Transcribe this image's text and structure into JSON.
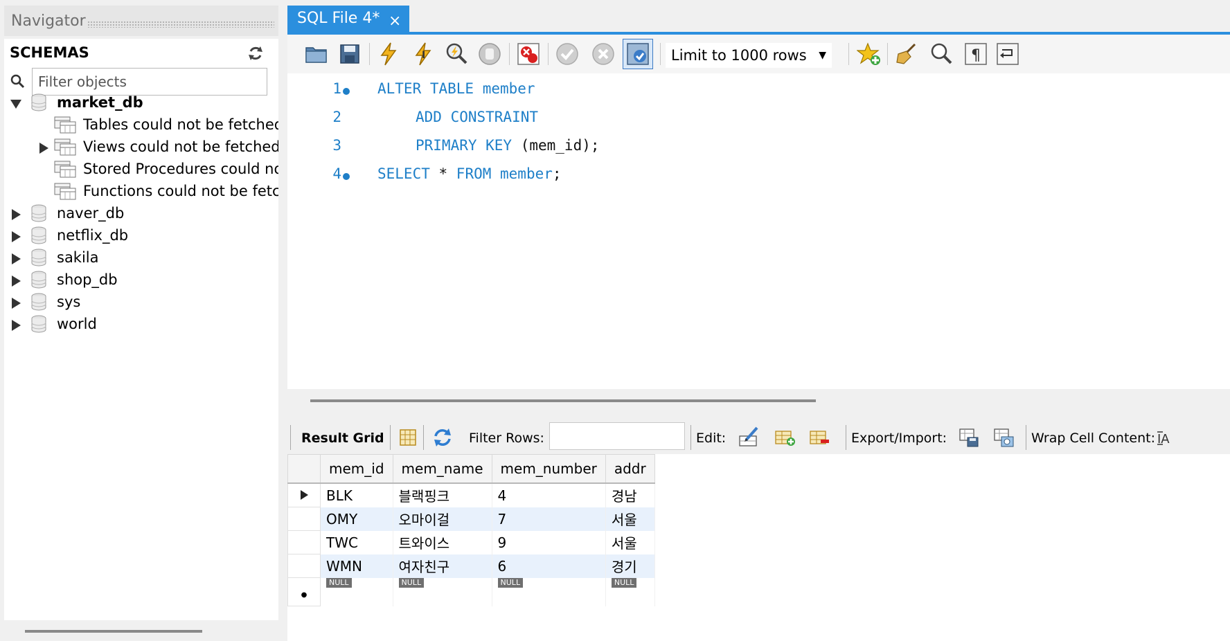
{
  "navigator": {
    "title": "Navigator",
    "schemas_label": "SCHEMAS",
    "filter_placeholder": "Filter objects",
    "schemas": [
      {
        "name": "market_db",
        "expanded": true,
        "bold": true,
        "children": [
          {
            "label": "Tables could not be fetched",
            "expandable": false
          },
          {
            "label": "Views could not be fetched",
            "expandable": true
          },
          {
            "label": "Stored Procedures could not be fetched",
            "expandable": false
          },
          {
            "label": "Functions could not be fetched",
            "expandable": false
          }
        ]
      },
      {
        "name": "naver_db"
      },
      {
        "name": "netflix_db"
      },
      {
        "name": "sakila"
      },
      {
        "name": "shop_db"
      },
      {
        "name": "sys"
      },
      {
        "name": "world"
      }
    ]
  },
  "tab": {
    "label": "SQL File 4*",
    "close": "×"
  },
  "toolbar": {
    "icons": [
      "open-folder-icon",
      "save-icon",
      "execute-icon",
      "execute-current-icon",
      "explain-icon",
      "stop-icon",
      "toggle-error-icon",
      "commit-icon",
      "rollback-icon",
      "autocommit-icon"
    ],
    "limit_label": "Limit to 1000 rows",
    "right_icons": [
      "add-snippet-icon",
      "beautify-icon",
      "find-icon",
      "invisible-chars-icon",
      "wrap-icon"
    ]
  },
  "editor": {
    "lines": [
      {
        "num": "1",
        "dot": true,
        "indent": 0,
        "tokens": [
          {
            "t": "ALTER TABLE member",
            "k": true
          }
        ]
      },
      {
        "num": "2",
        "dot": false,
        "indent": 1,
        "tokens": [
          {
            "t": "ADD CONSTRAINT",
            "k": true
          }
        ]
      },
      {
        "num": "3",
        "dot": false,
        "indent": 1,
        "tokens": [
          {
            "t": "PRIMARY KEY",
            "k": true
          },
          {
            "t": " (mem_id);",
            "k": false
          }
        ]
      },
      {
        "num": "4",
        "dot": true,
        "indent": 0,
        "tokens": [
          {
            "t": "SELECT",
            "k": true
          },
          {
            "t": " * ",
            "k": false
          },
          {
            "t": "FROM member",
            "k": true
          },
          {
            "t": ";",
            "k": false
          }
        ]
      }
    ]
  },
  "result_bar": {
    "result_grid": "Result Grid",
    "filter_rows": "Filter Rows:",
    "edit": "Edit:",
    "export_import": "Export/Import:",
    "wrap": "Wrap Cell Content:"
  },
  "grid": {
    "columns": [
      "mem_id",
      "mem_name",
      "mem_number",
      "addr"
    ],
    "rows": [
      [
        "BLK",
        "블랙핑크",
        "4",
        "경남"
      ],
      [
        "OMY",
        "오마이걸",
        "7",
        "서울"
      ],
      [
        "TWC",
        "트와이스",
        "9",
        "서울"
      ],
      [
        "WMN",
        "여자친구",
        "6",
        "경기"
      ]
    ],
    "null_label": "NULL"
  },
  "colors": {
    "accent": "#2b8fde",
    "keyword": "#1e7fc8",
    "row_alt": "#e8f1fc"
  }
}
